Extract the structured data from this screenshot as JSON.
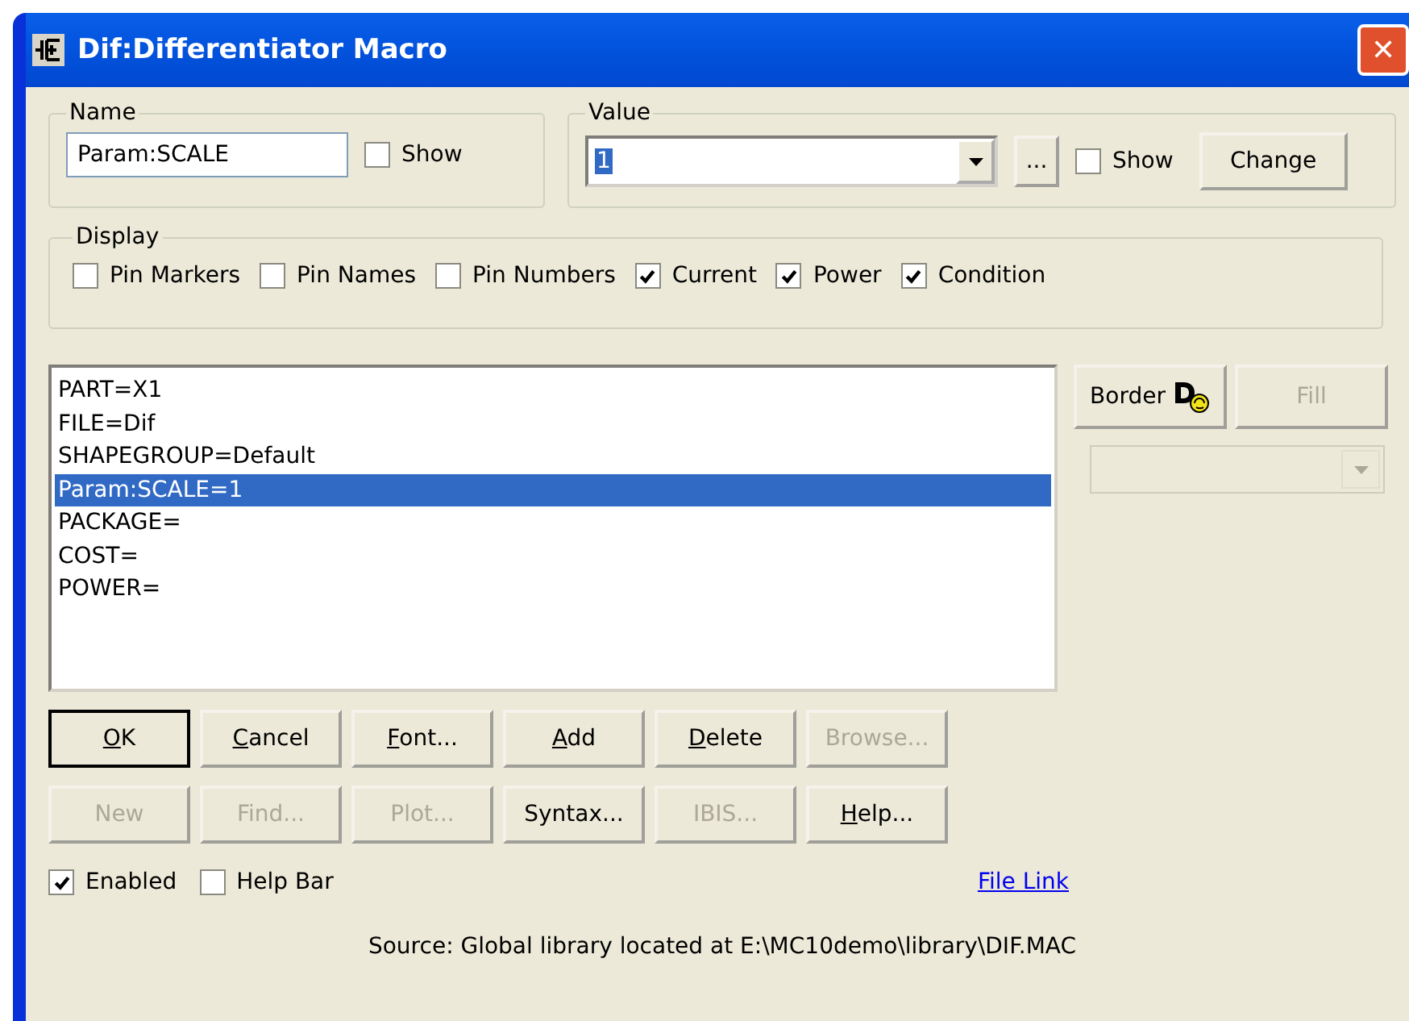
{
  "window": {
    "title": "Dif:Differentiator Macro",
    "close": "✕"
  },
  "name_group": {
    "label": "Name",
    "value": "Param:SCALE",
    "show": {
      "label": "Show",
      "checked": false
    }
  },
  "value_group": {
    "label": "Value",
    "value": "1",
    "ellipsis": "...",
    "show": {
      "label": "Show",
      "checked": false
    },
    "change": "Change"
  },
  "display": {
    "label": "Display",
    "options": [
      {
        "label": "Pin Markers",
        "checked": false
      },
      {
        "label": "Pin Names",
        "checked": false
      },
      {
        "label": "Pin Numbers",
        "checked": false
      },
      {
        "label": "Current",
        "checked": true
      },
      {
        "label": "Power",
        "checked": true
      },
      {
        "label": "Condition",
        "checked": true
      }
    ]
  },
  "attributes": [
    {
      "text": "PART=X1",
      "selected": false
    },
    {
      "text": "FILE=Dif",
      "selected": false
    },
    {
      "text": "SHAPEGROUP=Default",
      "selected": false
    },
    {
      "text": "Param:SCALE=1",
      "selected": true
    },
    {
      "text": "PACKAGE=",
      "selected": false
    },
    {
      "text": "COST=",
      "selected": false
    },
    {
      "text": "POWER=",
      "selected": false
    }
  ],
  "side_buttons": [
    {
      "label": "Border",
      "disabled": false,
      "icon": true
    },
    {
      "label": "Fill",
      "disabled": true,
      "icon": false
    }
  ],
  "side_combo": {
    "disabled": true
  },
  "button_rows": [
    [
      {
        "label": "OK",
        "disabled": false,
        "mnemonic": true,
        "default": true
      },
      {
        "label": "Cancel",
        "disabled": false,
        "mnemonic": true,
        "default": false
      },
      {
        "label": "Font...",
        "disabled": false,
        "mnemonic": true,
        "default": false
      },
      {
        "label": "Add",
        "disabled": false,
        "mnemonic": true,
        "default": false
      },
      {
        "label": "Delete",
        "disabled": false,
        "mnemonic": true,
        "default": false
      },
      {
        "label": "Browse...",
        "disabled": true,
        "mnemonic": false,
        "default": false
      }
    ],
    [
      {
        "label": "New",
        "disabled": true,
        "mnemonic": false,
        "default": false
      },
      {
        "label": "Find...",
        "disabled": true,
        "mnemonic": false,
        "default": false
      },
      {
        "label": "Plot...",
        "disabled": true,
        "mnemonic": false,
        "default": false
      },
      {
        "label": "Syntax...",
        "disabled": false,
        "mnemonic": false,
        "default": false
      },
      {
        "label": "IBIS...",
        "disabled": true,
        "mnemonic": false,
        "default": false
      },
      {
        "label": "Help...",
        "disabled": false,
        "mnemonic": true,
        "default": false
      }
    ]
  ],
  "options": [
    {
      "label": "Enabled",
      "checked": true
    },
    {
      "label": "Help Bar",
      "checked": false
    }
  ],
  "file_link": "File Link",
  "source": "Source: Global library located at E:\\MC10demo\\library\\DIF.MAC"
}
